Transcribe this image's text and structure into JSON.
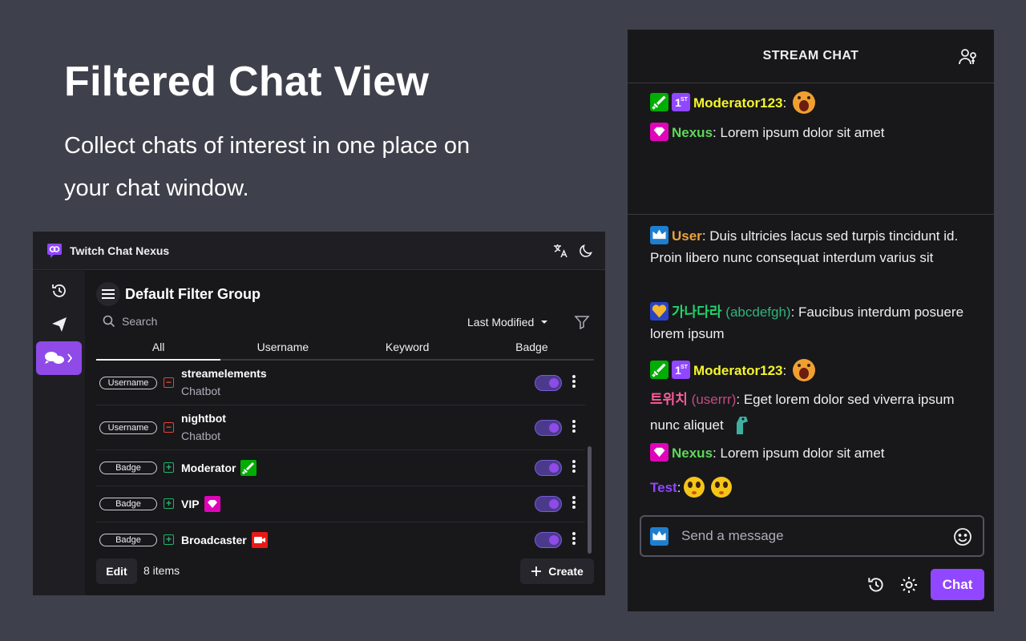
{
  "hero": {
    "title": "Filtered Chat View",
    "subtitle": "Collect chats of interest in one place on your chat window."
  },
  "app": {
    "name": "Twitch Chat Nexus",
    "group_title": "Default Filter Group",
    "search_placeholder": "Search",
    "sort_label": "Last Modified",
    "tabs": [
      {
        "label": "All"
      },
      {
        "label": "Username"
      },
      {
        "label": "Keyword"
      },
      {
        "label": "Badge"
      }
    ],
    "filters": [
      {
        "type": "Username",
        "sign": "−",
        "name": "streamelements",
        "sub": "Chatbot",
        "enabled": true
      },
      {
        "type": "Username",
        "sign": "−",
        "name": "nightbot",
        "sub": "Chatbot",
        "enabled": true
      },
      {
        "type": "Badge",
        "sign": "+",
        "name": "Moderator",
        "badge": "moderator-badge-icon",
        "enabled": true
      },
      {
        "type": "Badge",
        "sign": "+",
        "name": "VIP",
        "badge": "vip-badge-icon",
        "enabled": true
      },
      {
        "type": "Badge",
        "sign": "+",
        "name": "Broadcaster",
        "badge": "broadcaster-badge-icon",
        "enabled": true
      }
    ],
    "edit_label": "Edit",
    "items_count": "8 items",
    "create_label": "Create"
  },
  "chat": {
    "title": "STREAM CHAT",
    "pinned": [
      {
        "name": "Moderator123",
        "name_color": "#f5f529",
        "text": ""
      },
      {
        "name": "Nexus",
        "name_color": "#5fd65a",
        "text": " Lorem ipsum dolor sit amet"
      }
    ],
    "messages": [
      {
        "name": "User",
        "name_color": "#e8a33a",
        "text": " Duis ultricies lacus sed turpis tincidunt id. Proin libero nunc consequat interdum varius sit"
      },
      {
        "name": "가나다라",
        "login": "(abcdefgh)",
        "name_color": "#21d66b",
        "text": " Faucibus interdum posuere lorem ipsum"
      },
      {
        "name": "Moderator123",
        "name_color": "#f5f529",
        "text": ""
      },
      {
        "name": "트위치",
        "login": "(userrr)",
        "name_color": "#ff5c9c",
        "text": " Eget lorem dolor sed viverra ipsum nunc aliquet"
      },
      {
        "name": "Nexus",
        "name_color": "#5fd65a",
        "text": " Lorem ipsum dolor sit amet"
      },
      {
        "name": "Test",
        "name_color": "#9147ff",
        "text": ""
      }
    ],
    "input_placeholder": "Send a message",
    "send_label": "Chat"
  },
  "colors": {
    "accent": "#9147ff",
    "toggle": "#8f4ae8",
    "moderator": "#00ad03",
    "vip": "#e005b9",
    "broadcaster": "#e91916",
    "sub_badge": "#1f7fce"
  }
}
